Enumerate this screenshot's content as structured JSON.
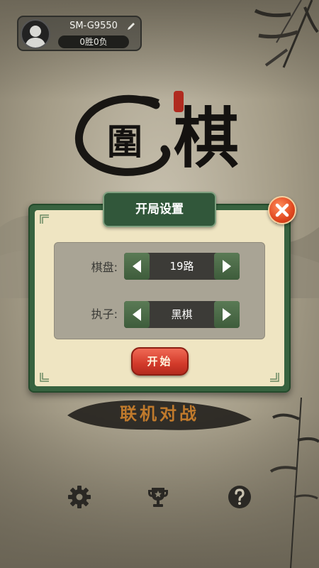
{
  "player": {
    "name": "SM-G9550",
    "record": "0胜0负"
  },
  "logo": {
    "char1": "圍",
    "char2": "棋"
  },
  "dialog": {
    "title": "开局设置",
    "rows": [
      {
        "label": "棋盘:",
        "value": "19路"
      },
      {
        "label": "执子:",
        "value": "黑棋"
      }
    ],
    "start_label": "开始"
  },
  "online_battle_label": "联机对战",
  "icons": {
    "avatar": "user-silhouette-icon",
    "edit": "pencil-icon",
    "close": "close-icon",
    "settings": "gear-icon",
    "ranking": "trophy-icon",
    "help": "question-icon"
  },
  "colors": {
    "dialog_green": "#37623f",
    "panel_cream": "#efe5c2",
    "close_red": "#e0471f",
    "start_red": "#d23a2a",
    "title_gold": "#c07a2c"
  }
}
